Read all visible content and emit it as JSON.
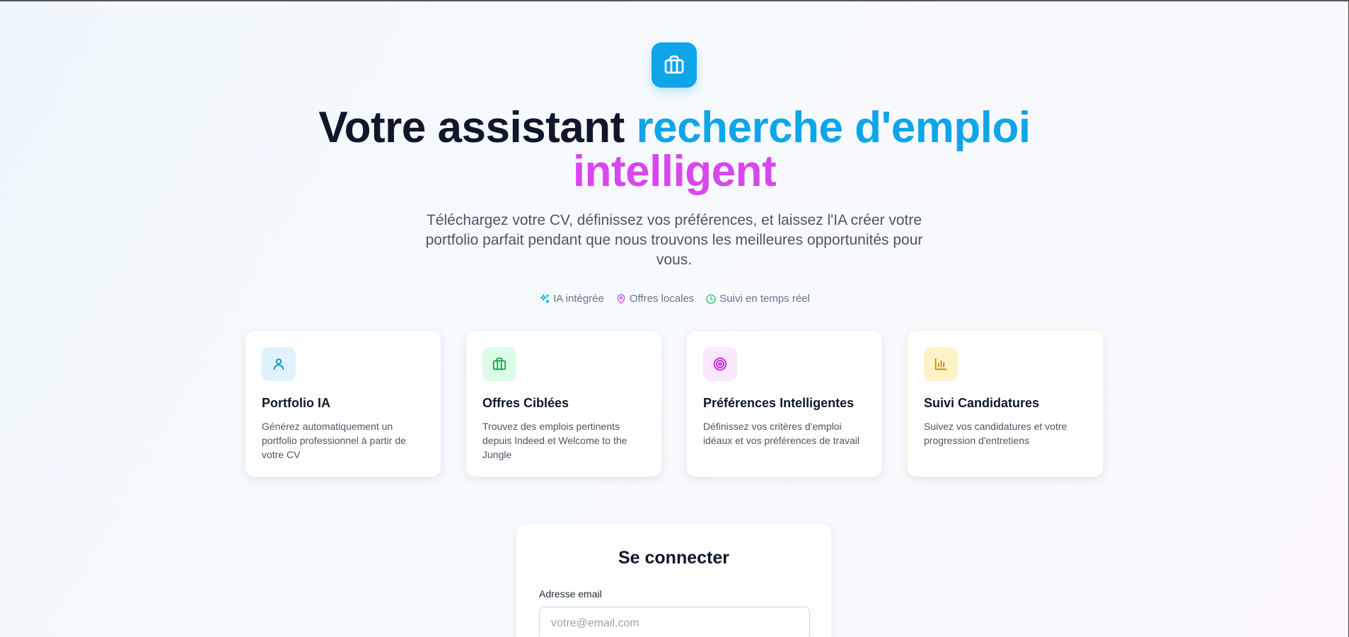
{
  "hero": {
    "title_part1": "Votre assistant ",
    "title_part2": "recherche d'emploi",
    "title_part3": "intelligent",
    "subtitle": "Téléchargez votre CV, définissez vos préférences, et laissez l'IA créer votre portfolio parfait pendant que nous trouvons les meilleures opportunités pour vous."
  },
  "tags": [
    {
      "label": "IA intégrée",
      "icon": "sparkles-icon",
      "color": "#0ea5e9"
    },
    {
      "label": "Offres locales",
      "icon": "map-pin-icon",
      "color": "#d946ef"
    },
    {
      "label": "Suivi en temps réel",
      "icon": "clock-icon",
      "color": "#22c55e"
    }
  ],
  "features": [
    {
      "title": "Portfolio IA",
      "description": "Générez automatiquement un portfolio professionnel à partir de votre CV",
      "icon": "user-icon",
      "color": "#0ea5e9",
      "bg": "#e0f2fe"
    },
    {
      "title": "Offres Ciblées",
      "description": "Trouvez des emplois pertinents depuis Indeed et Welcome to the Jungle",
      "icon": "briefcase-icon",
      "color": "#16a34a",
      "bg": "#dcfce7"
    },
    {
      "title": "Préférences Intelligentes",
      "description": "Définissez vos critères d'emploi idéaux et vos préférences de travail",
      "icon": "target-icon",
      "color": "#c026d3",
      "bg": "#fae8ff"
    },
    {
      "title": "Suivi Candidatures",
      "description": "Suivez vos candidatures et votre progression d'entretiens",
      "icon": "bar-chart-icon",
      "color": "#ca8a04",
      "bg": "#fef3c7"
    }
  ],
  "login": {
    "title": "Se connecter",
    "email_label": "Adresse email",
    "email_placeholder": "votre@email.com",
    "email_value": ""
  },
  "colors": {
    "primary": "#0ea5e9",
    "accent": "#d946ef",
    "text": "#0f172a"
  }
}
